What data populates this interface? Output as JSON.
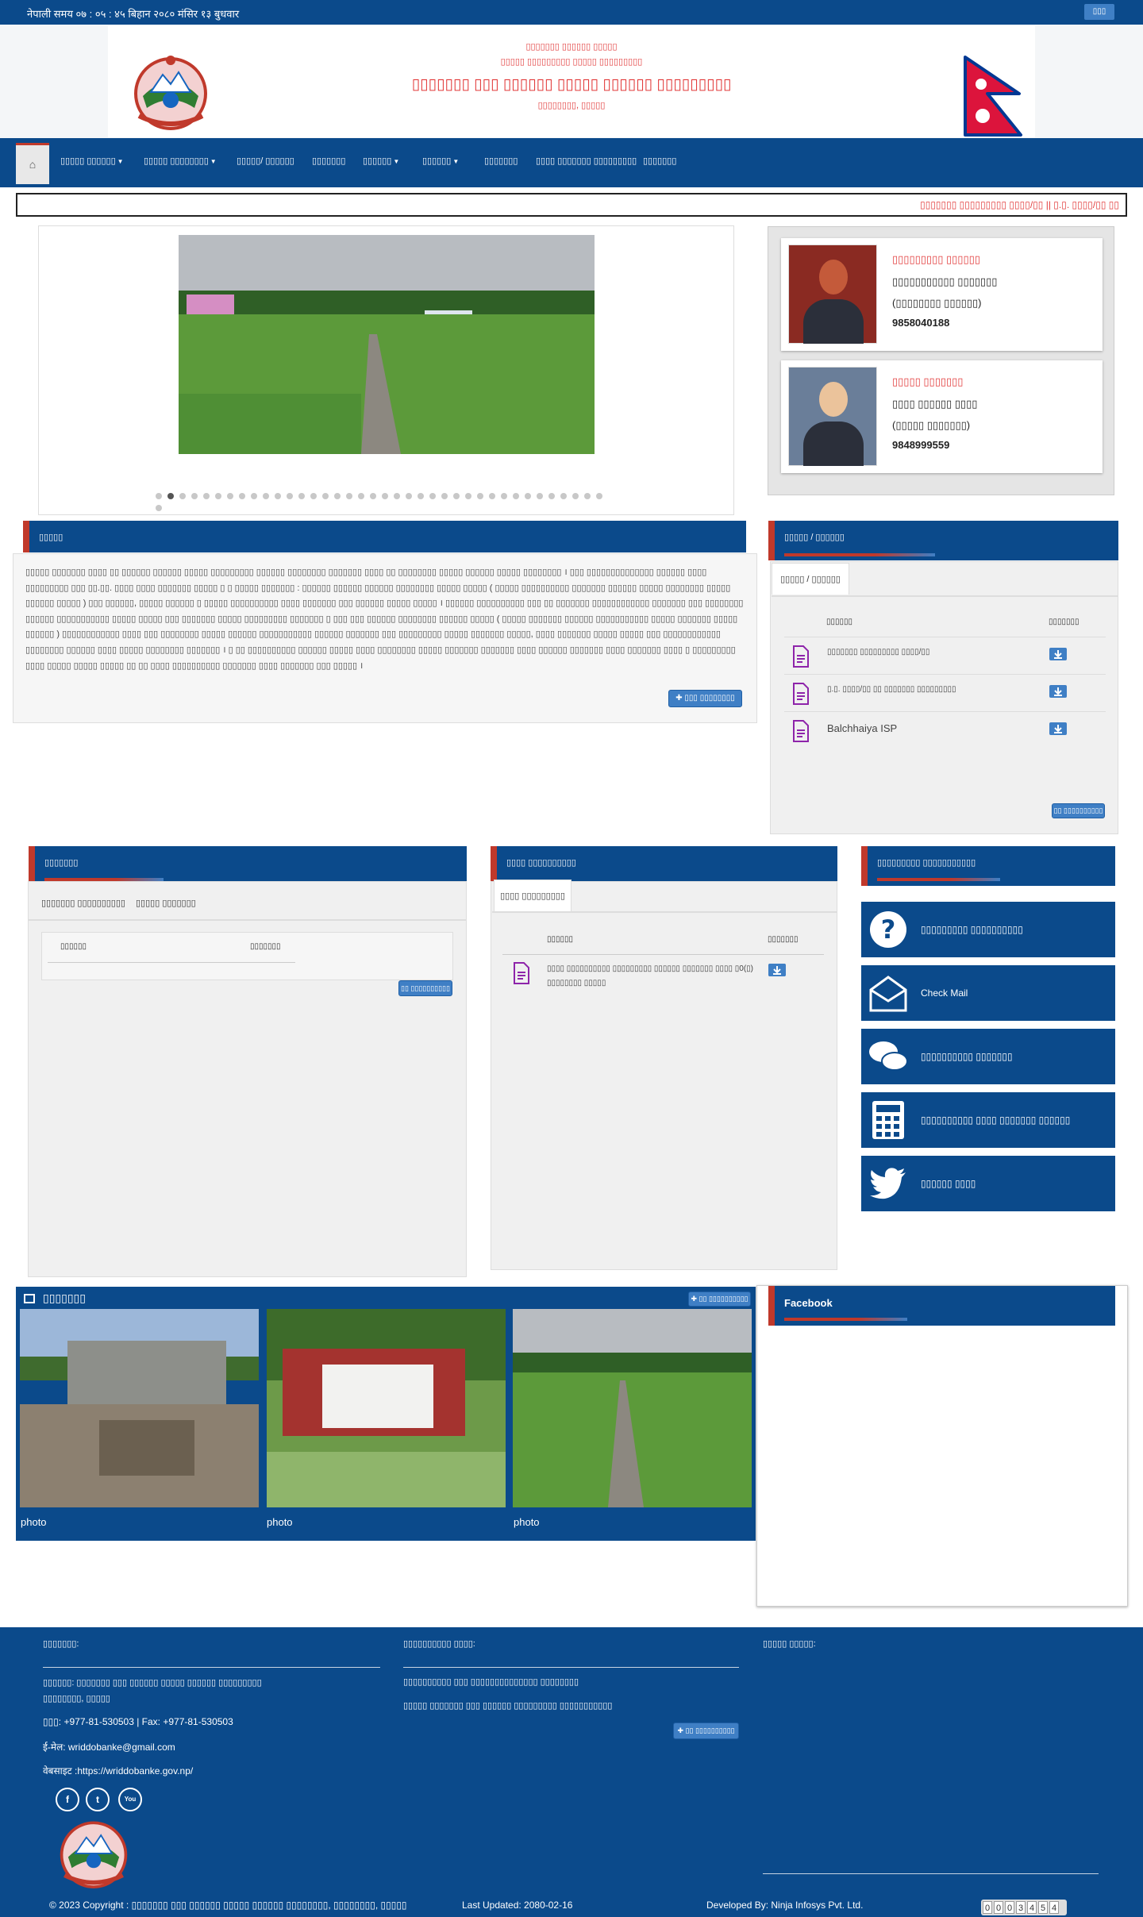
{
  "topbar": {
    "time": "नेपाली समय ०७ : ०५ : ४५ बिहान   २०८० मंसिर १३ बुधवार",
    "lang_button": "▯▯▯"
  },
  "header": {
    "line1": "▯▯▯▯▯▯▯ ▯▯▯▯▯▯ ▯▯▯▯▯",
    "line2": "▯▯▯▯▯ ▯▯▯▯▯▯▯▯▯ ▯▯▯▯▯ ▯▯▯▯▯▯▯▯▯",
    "title": "▯▯▯▯▯▯▯ ▯▯▯ ▯▯▯▯▯▯ ▯▯▯▯▯ ▯▯▯▯▯▯ ▯▯▯▯▯▯▯▯▯",
    "location": "▯▯▯▯▯▯▯▯, ▯▯▯▯▯"
  },
  "nav": {
    "items": [
      {
        "label": "▯▯▯▯▯ ▯▯▯▯▯▯",
        "dropdown": true
      },
      {
        "label": "▯▯▯▯▯ ▯▯▯▯▯▯▯▯",
        "dropdown": true
      },
      {
        "label": "▯▯▯▯▯/ ▯▯▯▯▯▯",
        "dropdown": false
      },
      {
        "label": "▯▯▯▯▯▯▯",
        "dropdown": false
      },
      {
        "label": "▯▯▯▯▯▯",
        "dropdown": true
      },
      {
        "label": "▯▯▯▯▯▯",
        "dropdown": true
      },
      {
        "label": "▯▯▯▯▯▯▯",
        "dropdown": false
      },
      {
        "label": "▯▯▯▯ ▯▯▯▯▯▯▯ ▯▯▯▯▯▯▯▯▯",
        "dropdown": false
      },
      {
        "label": "▯▯▯▯▯▯▯",
        "dropdown": false
      }
    ]
  },
  "ticker": {
    "text": "▯▯▯▯▯▯▯ ▯▯▯▯▯▯▯▯▯ ▯▯▯▯/▯▯ ||    ▯.▯. ▯▯▯▯/▯▯ ▯▯"
  },
  "staff": [
    {
      "role": "▯▯▯▯▯▯▯▯▯ ▯▯▯▯▯▯",
      "name": "▯▯▯▯▯▯▯▯▯▯▯ ▯▯▯▯▯▯▯",
      "post": "(▯▯▯▯▯▯▯▯ ▯▯▯▯▯▯)",
      "phone": "9858040188"
    },
    {
      "role": "▯▯▯▯▯ ▯▯▯▯▯▯▯",
      "name": "▯▯▯▯ ▯▯▯▯▯▯ ▯▯▯▯",
      "post": "(▯▯▯▯▯ ▯▯▯▯▯▯▯)",
      "phone": "9848999559"
    }
  ],
  "slider": {
    "dot_count": 39,
    "active_dot": 1
  },
  "about": {
    "title": "▯▯▯▯▯",
    "text": "▯▯▯▯▯ ▯▯▯▯▯▯▯ ▯▯▯▯ ▯▯ ▯▯▯▯▯▯ ▯▯▯▯▯▯ ▯▯▯▯▯ ▯▯▯▯▯▯▯▯▯ ▯▯▯▯▯▯ ▯▯▯▯▯▯▯▯ ▯▯▯▯▯▯▯ ▯▯▯▯ ▯▯ ▯▯▯▯▯▯▯▯ ▯▯▯▯▯ ▯▯▯▯▯▯ ▯▯▯▯▯ ▯▯▯▯▯▯▯▯ । ▯▯▯ ▯▯▯▯▯▯▯▯▯▯▯▯▯▯ ▯▯▯▯▯▯ ▯▯▯▯ ▯▯▯▯▯▯▯▯▯ ▯▯▯ ▯▯.▯▯. ▯▯▯▯ ▯▯▯▯ ▯▯▯▯▯▯▯ ▯▯▯▯▯ ▯ ▯ ▯▯▯▯▯ ▯▯▯▯▯▯▯ : ▯▯▯▯▯▯ ▯▯▯▯▯▯ ▯▯▯▯▯▯ ▯▯▯▯▯▯▯▯ ▯▯▯▯▯ ▯▯▯▯▯ ( ▯▯▯▯▯ ▯▯▯▯▯▯▯▯▯▯ ▯▯▯▯▯▯▯ ▯▯▯▯▯▯ ▯▯▯▯▯ ▯▯▯▯▯▯▯▯ ▯▯▯▯▯ ▯▯▯▯▯▯ ▯▯▯▯▯ ) ▯▯▯ ▯▯▯▯▯▯, ▯▯▯▯▯ ▯▯▯▯▯▯ ▯ ▯▯▯▯▯ ▯▯▯▯▯▯▯▯▯▯ ▯▯▯▯ ▯▯▯▯▯▯▯ ▯▯▯ ▯▯▯▯▯▯ ▯▯▯▯▯ ▯▯▯▯▯ । ▯▯▯▯▯▯ ▯▯▯▯▯▯▯▯▯▯ ▯▯▯ ▯▯ ▯▯▯▯▯▯▯ ▯▯▯▯▯▯▯▯▯▯▯▯ ▯▯▯▯▯▯▯ ▯▯▯ ▯▯▯▯▯▯▯▯ ▯▯▯▯▯▯ ▯▯▯▯▯▯▯▯▯▯▯ ▯▯▯▯▯ ▯▯▯▯▯ ▯▯▯ ▯▯▯▯▯▯▯ ▯▯▯▯▯ ▯▯▯▯▯▯▯▯▯ ▯▯▯▯▯▯▯ ▯ ▯▯▯ ▯▯▯ ▯▯▯▯▯▯ ▯▯▯▯▯▯▯▯ ▯▯▯▯▯▯ ▯▯▯▯▯ ( ▯▯▯▯▯ ▯▯▯▯▯▯▯ ▯▯▯▯▯▯ ▯▯▯▯▯▯▯▯▯▯▯ ▯▯▯▯▯ ▯▯▯▯▯▯▯ ▯▯▯▯▯ ▯▯▯▯▯▯ ) ▯▯▯▯▯▯▯▯▯▯▯▯ ▯▯▯▯ ▯▯▯ ▯▯▯▯▯▯▯▯ ▯▯▯▯▯ ▯▯▯▯▯▯ ▯▯▯▯▯▯▯▯▯▯▯ ▯▯▯▯▯▯ ▯▯▯▯▯▯▯ ▯▯▯ ▯▯▯▯▯▯▯▯▯ ▯▯▯▯▯ ▯▯▯▯▯▯▯ ▯▯▯▯▯, ▯▯▯▯ ▯▯▯▯▯▯▯ ▯▯▯▯▯ ▯▯▯▯▯ ▯▯▯ ▯▯▯▯▯▯▯▯▯▯▯▯ ▯▯▯▯▯▯▯▯ ▯▯▯▯▯▯ ▯▯▯▯ ▯▯▯▯▯ ▯▯▯▯▯▯▯▯ ▯▯▯▯▯▯▯ । ▯ ▯▯ ▯▯▯▯▯▯▯▯▯▯ ▯▯▯▯▯▯ ▯▯▯▯▯ ▯▯▯▯ ▯▯▯▯▯▯▯▯ ▯▯▯▯▯ ▯▯▯▯▯▯▯ ▯▯▯▯▯▯▯ ▯▯▯▯ ▯▯▯▯▯▯ ▯▯▯▯▯▯▯ ▯▯▯▯ ▯▯▯▯▯▯▯ ▯▯▯▯ ▯ ▯▯▯▯▯▯▯▯▯ ▯▯▯▯ ▯▯▯▯▯ ▯▯▯▯▯ ▯▯▯▯▯ ▯▯ ▯▯ ▯▯▯▯ ▯▯▯▯▯▯▯▯▯▯ ▯▯▯▯▯▯▯ ▯▯▯▯ ▯▯▯▯▯▯▯ ▯▯▯ ▯▯▯▯▯ ।",
    "more_button": "✚ ▯▯▯ ▯▯▯▯▯▯▯▯"
  },
  "notices": {
    "title": "▯▯▯▯▯ / ▯▯▯▯▯▯",
    "tab": "▯▯▯▯▯ / ▯▯▯▯▯▯",
    "col_title": "▯▯▯▯▯▯",
    "col_download": "▯▯▯▯▯▯▯",
    "rows": [
      {
        "title": "▯▯▯▯▯▯▯ ▯▯▯▯▯▯▯▯▯ ▯▯▯▯/▯▯"
      },
      {
        "title": "▯.▯. ▯▯▯▯/▯▯ ▯▯ ▯▯▯▯▯▯▯ ▯▯▯▯▯▯▯▯▯"
      },
      {
        "title": "Balchhaiya ISP"
      }
    ],
    "all_button": "▯▯ ▯▯▯▯▯▯▯▯▯▯"
  },
  "activities": {
    "title": "▯▯▯▯▯▯▯",
    "tabs": [
      "▯▯▯▯▯▯▯ ▯▯▯▯▯▯▯▯▯▯",
      "▯▯▯▯▯ ▯▯▯▯▯▯▯"
    ],
    "col_title": "▯▯▯▯▯▯",
    "col_download": "▯▯▯▯▯▯▯",
    "all_button": "▯▯ ▯▯▯▯▯▯▯▯▯▯"
  },
  "publications": {
    "title": "▯▯▯▯ ▯▯▯▯▯▯▯▯▯▯",
    "tab": "▯▯▯▯ ▯▯▯▯▯▯▯▯▯",
    "col_title": "▯▯▯▯▯▯",
    "col_download": "▯▯▯▯▯▯▯",
    "rows": [
      {
        "title": "▯▯▯▯ ▯▯▯▯▯▯▯▯▯▯ ▯▯▯▯▯▯▯▯▯ ▯▯▯▯▯▯ ▯▯▯▯▯▯▯ ▯▯▯▯ ▯0(▯) ▯▯▯▯▯▯▯▯ ▯▯▯▯▯"
      }
    ]
  },
  "quick_links": {
    "title": "▯▯▯▯▯▯▯▯▯ ▯▯▯▯▯▯▯▯▯▯▯",
    "items": [
      {
        "label": "▯▯▯▯▯▯▯▯▯ ▯▯▯▯▯▯▯▯▯▯",
        "icon": "question-icon"
      },
      {
        "label": "Check Mail",
        "icon": "mail-icon"
      },
      {
        "label": "▯▯▯▯▯▯▯▯▯▯ ▯▯▯▯▯▯▯",
        "icon": "chat-icon"
      },
      {
        "label": "▯▯▯▯▯▯▯▯▯▯ ▯▯▯▯ ▯▯▯▯▯▯▯ ▯▯▯▯▯▯",
        "icon": "calculator-icon"
      },
      {
        "label": "▯▯▯▯▯▯ ▯▯▯▯",
        "icon": "twitter-icon"
      }
    ]
  },
  "gallery": {
    "title": "▯▯▯▯▯▯▯",
    "more_button": "✚ ▯▯ ▯▯▯▯▯▯▯▯▯▯",
    "items": [
      {
        "label": "photo"
      },
      {
        "label": "photo"
      },
      {
        "label": "photo"
      }
    ]
  },
  "facebook": {
    "title": "Facebook"
  },
  "footer": {
    "contact_title": "▯▯▯▯▯▯▯:",
    "address1": "▯▯▯▯▯▯: ▯▯▯▯▯▯▯ ▯▯▯ ▯▯▯▯▯▯ ▯▯▯▯▯ ▯▯▯▯▯▯ ▯▯▯▯▯▯▯▯▯",
    "address2": "▯▯▯▯▯▯▯▯, ▯▯▯▯▯",
    "phone": "▯▯▯: +977-81-530503 | Fax: +977-81-530503",
    "email": "ई-मेल: wriddobanke@gmail.com",
    "website": "वेबसाइट :https://wriddobanke.gov.np/",
    "links_title": "▯▯▯▯▯▯▯▯▯▯ ▯▯▯▯:",
    "link1": "▯▯▯▯▯▯▯▯▯▯ ▯▯▯ ▯▯▯▯▯▯▯▯▯▯▯▯▯▯ ▯▯▯▯▯▯▯▯",
    "link2": "▯▯▯▯▯ ▯▯▯▯▯▯▯ ▯▯▯ ▯▯▯▯▯▯ ▯▯▯▯▯▯▯▯▯ ▯▯▯▯▯▯▯▯▯▯▯",
    "links_button": "✚ ▯▯ ▯▯▯▯▯▯▯▯▯▯",
    "map_title": "▯▯▯▯▯ ▯▯▯▯▯:",
    "copyright": "© 2023 Copyright : ▯▯▯▯▯▯▯ ▯▯▯ ▯▯▯▯▯▯ ▯▯▯▯▯ ▯▯▯▯▯▯ ▯▯▯▯▯▯▯▯, ▯▯▯▯▯▯▯▯, ▯▯▯▯▯",
    "updated": "Last Updated: 2080-02-16",
    "developer": "Developed By: Ninja Infosys Pvt. Ltd.",
    "visitor_count": "0003454",
    "social": [
      "f",
      "t",
      "You"
    ]
  }
}
